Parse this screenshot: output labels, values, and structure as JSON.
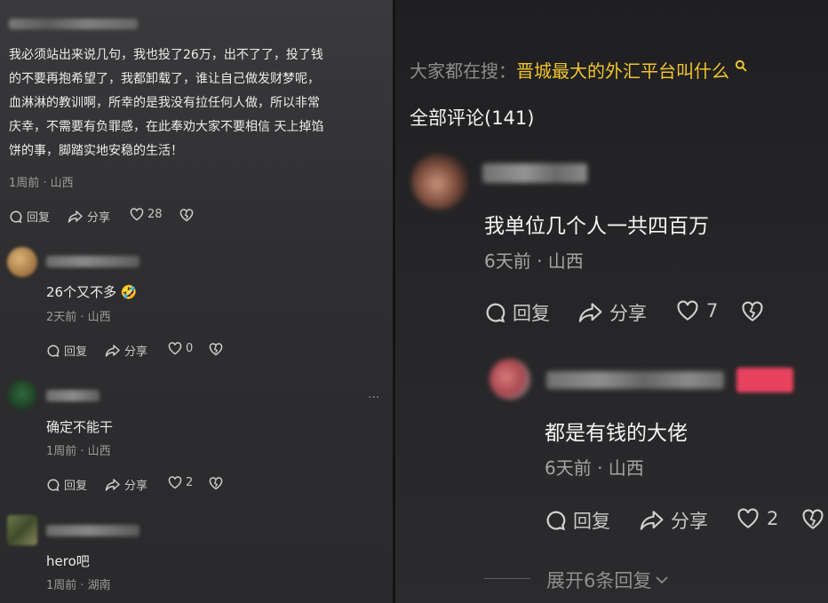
{
  "left": {
    "top_comment": {
      "text_lines": [
        "我必须站出来说几句，我也投了26万，出不了了，投了钱",
        "的不要再抱希望了，我都卸载了，谁让自己做发财梦呢，",
        "血淋淋的教训啊，所幸的是我没有拉任何人做，所以非常",
        "庆幸，不需要有负罪感，在此奉劝大家不要相信 天上掉馅",
        "饼的事，脚踏实地安稳的生活！"
      ],
      "meta": "1周前 · 山西",
      "reply": "回复",
      "share": "分享",
      "likes": "28"
    },
    "replies": [
      {
        "text": "26个又不多 🤣",
        "meta": "2天前 · 山西",
        "reply": "回复",
        "share": "分享",
        "likes": "0"
      },
      {
        "text": "确定不能干",
        "meta": "1周前 · 山西",
        "reply": "回复",
        "share": "分享",
        "likes": "2",
        "more": "···"
      },
      {
        "text": "hero吧",
        "meta": "1周前 · 湖南"
      }
    ]
  },
  "right": {
    "search_prefix": "大家都在搜：",
    "search_query": "晋城最大的外汇平台叫什么",
    "comments_title": "全部评论(141)",
    "comment": {
      "text": "我单位几个人一共四百万",
      "meta": "6天前 · 山西",
      "reply": "回复",
      "share": "分享",
      "likes": "7"
    },
    "reply": {
      "text": "都是有钱的大佬",
      "meta": "6天前 · 山西",
      "reply": "回复",
      "share": "分享",
      "likes": "2"
    },
    "expand": "展开6条回复",
    "colors": {
      "accent": "#f0c52e",
      "badge": "#e8425f"
    }
  }
}
